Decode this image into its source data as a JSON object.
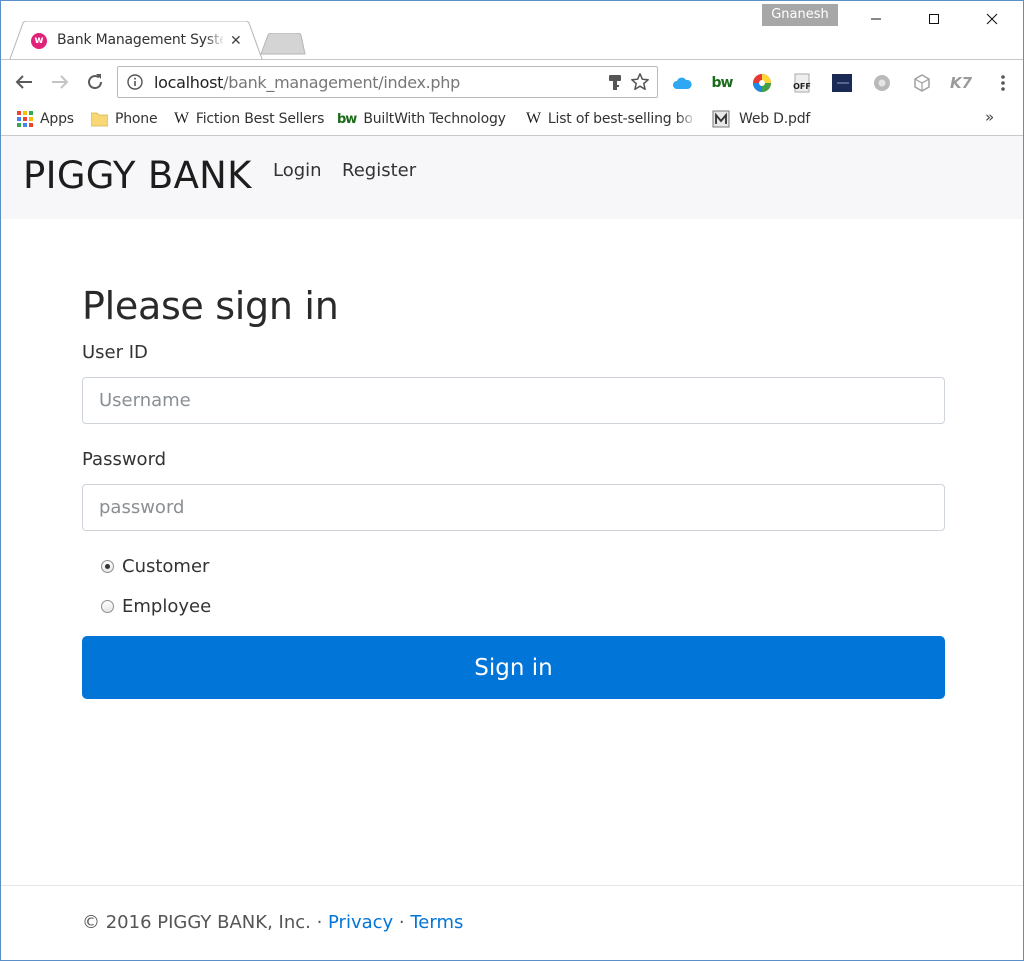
{
  "browser": {
    "profile_name": "Gnanesh",
    "tab": {
      "title": "Bank Management System",
      "favicon_letter": "w",
      "favicon_color": "#e2227a"
    },
    "address": {
      "host": "localhost",
      "path": "/bank_management/index.php"
    },
    "toolbar_icons": [
      "back-icon",
      "forward-icon",
      "reload-icon",
      "info-icon",
      "key-icon",
      "star-icon",
      "menu-icon"
    ],
    "extensions": [
      {
        "name": "cloud-extension-icon"
      },
      {
        "name": "builtwith-extension-icon",
        "text": "bw"
      },
      {
        "name": "color-wheel-extension-icon"
      },
      {
        "name": "off-extension-icon",
        "text": "OFF"
      },
      {
        "name": "paper-extension-icon"
      },
      {
        "name": "gear-cloud-extension-icon"
      },
      {
        "name": "cube-extension-icon"
      },
      {
        "name": "k7-extension-icon",
        "text": "K7"
      }
    ],
    "bookmarks": [
      {
        "label": "Apps",
        "icon": "apps-grid-icon"
      },
      {
        "label": "Phone",
        "icon": "folder-icon"
      },
      {
        "label": "Fiction Best Sellers",
        "icon": "wikipedia-icon"
      },
      {
        "label": "BuiltWith Technology",
        "icon": "builtwith-icon"
      },
      {
        "label": "List of best-selling bo",
        "icon": "wikipedia-icon"
      },
      {
        "label": "Web D.pdf",
        "icon": "pdf-icon"
      }
    ],
    "bookmarks_more": "»"
  },
  "navbar": {
    "brand": "PIGGY BANK",
    "links": [
      "Login",
      "Register"
    ]
  },
  "form": {
    "heading": "Please sign in",
    "userid_label": "User ID",
    "userid_placeholder": "Username",
    "password_label": "Password",
    "password_placeholder": "password",
    "roles": [
      {
        "label": "Customer",
        "checked": true
      },
      {
        "label": "Employee",
        "checked": false
      }
    ],
    "submit_label": "Sign in"
  },
  "footer": {
    "copyright": "© 2016 PIGGY BANK, Inc. · ",
    "privacy": "Privacy",
    "separator": " · ",
    "terms": "Terms"
  },
  "colors": {
    "primary": "#0275d8",
    "navbar_bg": "#f7f7f9",
    "window_border": "#5a8fc8"
  }
}
